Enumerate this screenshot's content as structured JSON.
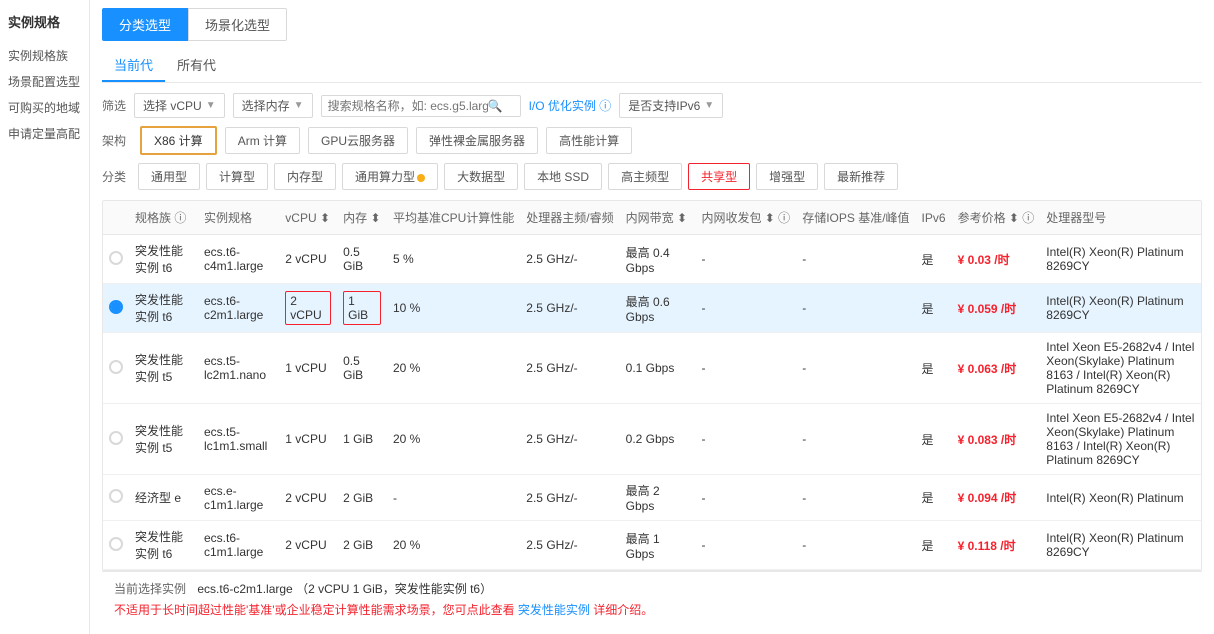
{
  "sidebar": {
    "title": "实例规格",
    "items": [
      {
        "label": "实例规格族"
      },
      {
        "label": "场景配置选型"
      },
      {
        "label": "可购买的地域"
      },
      {
        "label": "申请定量高配"
      }
    ]
  },
  "topTabs": [
    {
      "label": "分类选型",
      "active": true
    },
    {
      "label": "场景化选型",
      "active": false
    }
  ],
  "subTabs": [
    {
      "label": "当前代",
      "active": true
    },
    {
      "label": "所有代",
      "active": false
    }
  ],
  "filter": {
    "label": "筛选",
    "vcpu_placeholder": "选择 vCPU",
    "memory_placeholder": "选择内存",
    "search_placeholder": "搜索规格名称，如: ecs.g5.large",
    "io_link": "I/O 优化实例 ⓘ",
    "ipv6_label": "是否支持IPv6",
    "ipv6_arrow": "▼"
  },
  "arch": {
    "label": "架构",
    "buttons": [
      {
        "label": "X86 计算",
        "active": true
      },
      {
        "label": "Arm 计算",
        "active": false
      },
      {
        "label": "GPU云服务器",
        "active": false
      },
      {
        "label": "弹性裸金属服务器",
        "active": false
      },
      {
        "label": "高性能计算",
        "active": false
      }
    ]
  },
  "category": {
    "label": "分类",
    "buttons": [
      {
        "label": "通用型",
        "active": false,
        "dot": false
      },
      {
        "label": "计算型",
        "active": false,
        "dot": false
      },
      {
        "label": "内存型",
        "active": false,
        "dot": false
      },
      {
        "label": "通用算力型",
        "active": false,
        "dot": true
      },
      {
        "label": "大数据型",
        "active": false,
        "dot": false
      },
      {
        "label": "本地 SSD",
        "active": false,
        "dot": false
      },
      {
        "label": "高主频型",
        "active": false,
        "dot": false
      },
      {
        "label": "共享型",
        "active": true,
        "dot": false
      },
      {
        "label": "增强型",
        "active": false,
        "dot": false
      },
      {
        "label": "最新推荐",
        "active": false,
        "dot": false
      }
    ]
  },
  "table": {
    "columns": [
      {
        "key": "select",
        "label": ""
      },
      {
        "key": "family",
        "label": "规格族 ⓘ"
      },
      {
        "key": "spec",
        "label": "实例规格"
      },
      {
        "key": "vcpu",
        "label": "vCPU ⬍"
      },
      {
        "key": "memory",
        "label": "内存 ⬍"
      },
      {
        "key": "cpu_perf",
        "label": "平均基准CPU计算性能"
      },
      {
        "key": "processor",
        "label": "处理器主频/睿频"
      },
      {
        "key": "bandwidth",
        "label": "内网带宽 ⬍"
      },
      {
        "key": "pps",
        "label": "内网收发包 ⬍ ⓘ"
      },
      {
        "key": "iops",
        "label": "存储IOPS 基准/峰值"
      },
      {
        "key": "ipv6",
        "label": "IPv6"
      },
      {
        "key": "price",
        "label": "参考价格 ⬍ ⓘ"
      },
      {
        "key": "proc_model",
        "label": "处理器型号"
      }
    ],
    "rows": [
      {
        "selected": false,
        "family": "突发性能实例 t6",
        "spec": "ecs.t6-c4m1.large",
        "vcpu": "2 vCPU",
        "memory": "0.5 GiB",
        "cpu_perf": "5 %",
        "processor": "2.5 GHz/-",
        "bandwidth": "最高 0.4 Gbps",
        "pps": "-",
        "iops": "-",
        "ipv6": "是",
        "price": "¥ 0.03 /时",
        "proc_model": "Intel(R) Xeon(R) Platinum 8269CY"
      },
      {
        "selected": true,
        "family": "突发性能实例 t6",
        "spec": "ecs.t6-c2m1.large",
        "vcpu": "2 vCPU",
        "memory": "1 GiB",
        "cpu_perf": "10 %",
        "processor": "2.5 GHz/-",
        "bandwidth": "最高 0.6 Gbps",
        "pps": "-",
        "iops": "-",
        "ipv6": "是",
        "price": "¥ 0.059 /时",
        "proc_model": "Intel(R) Xeon(R) Platinum 8269CY"
      },
      {
        "selected": false,
        "family": "突发性能实例 t5",
        "spec": "ecs.t5-lc2m1.nano",
        "vcpu": "1 vCPU",
        "memory": "0.5 GiB",
        "cpu_perf": "20 %",
        "processor": "2.5 GHz/-",
        "bandwidth": "0.1 Gbps",
        "pps": "-",
        "iops": "-",
        "ipv6": "是",
        "price": "¥ 0.063 /时",
        "proc_model": "Intel Xeon E5-2682v4 / Intel Xeon(Skylake) Platinum 8163 / Intel(R) Xeon(R) Platinum 8269CY"
      },
      {
        "selected": false,
        "family": "突发性能实例 t5",
        "spec": "ecs.t5-lc1m1.small",
        "vcpu": "1 vCPU",
        "memory": "1 GiB",
        "cpu_perf": "20 %",
        "processor": "2.5 GHz/-",
        "bandwidth": "0.2 Gbps",
        "pps": "-",
        "iops": "-",
        "ipv6": "是",
        "price": "¥ 0.083 /时",
        "proc_model": "Intel Xeon E5-2682v4 / Intel Xeon(Skylake) Platinum 8163 / Intel(R) Xeon(R) Platinum 8269CY"
      },
      {
        "selected": false,
        "family": "经济型 e",
        "spec": "ecs.e-c1m1.large",
        "vcpu": "2 vCPU",
        "memory": "2 GiB",
        "cpu_perf": "-",
        "processor": "2.5 GHz/-",
        "bandwidth": "最高 2 Gbps",
        "pps": "-",
        "iops": "-",
        "ipv6": "是",
        "price": "¥ 0.094 /时",
        "proc_model": "Intel(R) Xeon(R) Platinum"
      },
      {
        "selected": false,
        "family": "突发性能实例 t6",
        "spec": "ecs.t6-c1m1.large",
        "vcpu": "2 vCPU",
        "memory": "2 GiB",
        "cpu_perf": "20 %",
        "processor": "2.5 GHz/-",
        "bandwidth": "最高 1 Gbps",
        "pps": "-",
        "iops": "-",
        "ipv6": "是",
        "price": "¥ 0.118 /时",
        "proc_model": "Intel(R) Xeon(R) Platinum 8269CY"
      }
    ]
  },
  "bottom": {
    "label": "当前选择实例",
    "value": "ecs.t6-c2m1.large  （2 vCPU 1 GiB，突发性能实例 t6）",
    "warning": "不适用于长时间超过性能'基准'或企业稳定计算性能需求场景，您可点此查看 突发性能实例 详细介绍。"
  }
}
